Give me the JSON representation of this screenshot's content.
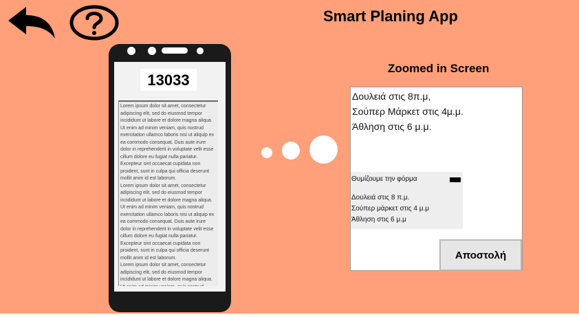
{
  "app": {
    "title": "Smart Planing App"
  },
  "toolbar": {
    "back_icon": "back-arrow-icon",
    "help_icon": "question-mark-icon"
  },
  "phone": {
    "code": "13033",
    "lorem": "Lorem ipsum dolor sit amet, consectetur adipiscing elit, sed do eiusmod tempor incididunt ut labore et dolore magna aliqua. Ut enim ad minim veniam, quis nostrud exercitation ullamco laboris nisi ut aliquip ex ea commodo consequat. Duis aute irure dolor in reprehenderit in voluptate velit esse cillum dolore eu fugiat nulla pariatur. Excepteur sint occaecat cupidata non proident, sunt in culpa qui officia deserunt mollit anim id est laborum.\nLorem ipsum dolor sit amet, consectetur adipiscing elit, sed do eiusmod tempor incididunt ut labore et dolore magna aliqua. Ut enim ad minim veniam, quis nostrud exercitation ullamco laboris nisi ut aliquip ex ea commodo consequat. Duis aute irure dolor in reprehenderit in voluptate velit esse cillum dolore eu fugiat nulla pariatur. Excepteur sint occaecat cupidata non proident, sunt in culpa qui officia deserunt mollit anim id est laborum.\nLorem ipsum dolor sit amet, consectetur adipiscing elit, sed do eiusmod tempor incididunt ut labore et dolore magna aliqua. Ut enim ad minim veniam, quis nostrud exercitation ullamco laboris nisi ut aliquip ex ea commodo consequat."
  },
  "zoom": {
    "title": "Zoomed in Screen",
    "tasks": [
      "Δουλειά στις 8π.μ,",
      "Σούπερ Μάρκετ στις 4μ.μ.",
      "Άθληση  στις 6 μ.μ."
    ],
    "reminder_title": "Θυμίζουμε την φόρμα",
    "reminder_lines": [
      "Δουλειά στις 8 π.μ.",
      "Σούπερ μάρκετ στις 4 μ.μ",
      "Άθληση στις 6 μ.μ"
    ]
  },
  "actions": {
    "send_label": "Αποστολή"
  },
  "colors": {
    "background": "#FFA07A",
    "phone_body": "#1a1a1a"
  }
}
